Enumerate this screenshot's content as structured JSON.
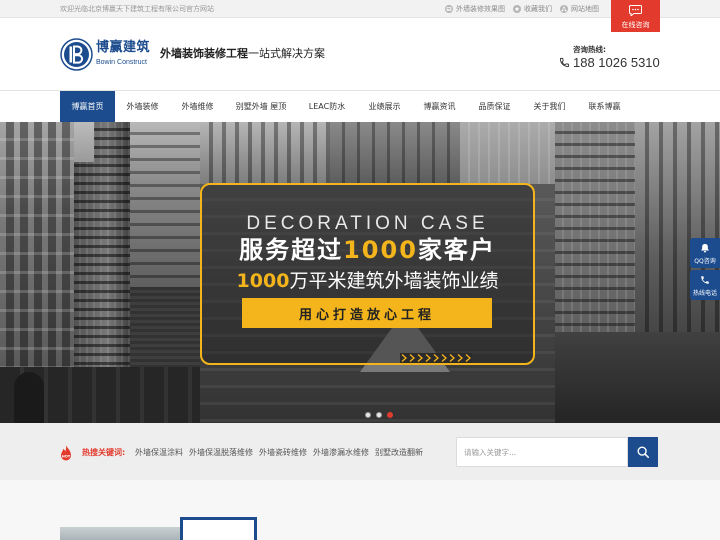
{
  "topbar": {
    "welcome": "欢迎光临北京博赢天下建筑工程有限公司官方网站",
    "links": [
      {
        "label": "外墙装修效果图",
        "icon": "image-icon"
      },
      {
        "label": "收藏我们",
        "icon": "star-icon"
      },
      {
        "label": "网站地图",
        "icon": "sitemap-icon"
      }
    ],
    "consult": {
      "label": "在线咨询",
      "icon": "chat-bubble-icon"
    }
  },
  "header": {
    "logo": {
      "name": "博赢建筑",
      "tagline": "Bowin Construct"
    },
    "slogan": {
      "bold": "外墙装饰装修工程",
      "rest": "一站式解决方案"
    },
    "hotline": {
      "label": "咨询热线:",
      "number": "188 1026 5310",
      "icon": "phone-icon"
    }
  },
  "nav": {
    "items": [
      "博赢首页",
      "外墙装修",
      "外墙维修",
      "别墅外墙 屋顶",
      "LEAC防水",
      "业绩展示",
      "博赢资讯",
      "品质保证",
      "关于我们",
      "联系博赢"
    ],
    "active_index": 0
  },
  "hero": {
    "eyebrow": "DECORATION CASE",
    "headline": {
      "pre": "服务超过",
      "num": "1000",
      "post": "家客户"
    },
    "subline": {
      "num": "1000",
      "post": "万平米建筑外墙装饰业绩"
    },
    "cta": "用心打造放心工程",
    "slider": {
      "count": 3,
      "active_index": 2
    }
  },
  "side_float": [
    {
      "label": "QQ咨询",
      "icon": "qq-icon"
    },
    {
      "label": "热线电话",
      "icon": "phone-icon"
    }
  ],
  "hot_search": {
    "badge": "HOT",
    "label": "热搜关键词:",
    "keywords": [
      "外墙保温涂料",
      "外墙保温脱落维修",
      "外墙瓷砖维修",
      "外墙渗漏水维修",
      "别墅改造翻新"
    ],
    "search_placeholder": "请输入关键字...",
    "search_icon": "search-icon"
  },
  "colors": {
    "brand_blue": "#1c4c8e",
    "accent_red": "#e33a2e",
    "accent_yellow": "#f4b51c",
    "text_dark": "#333333",
    "muted_gray": "#999999"
  }
}
